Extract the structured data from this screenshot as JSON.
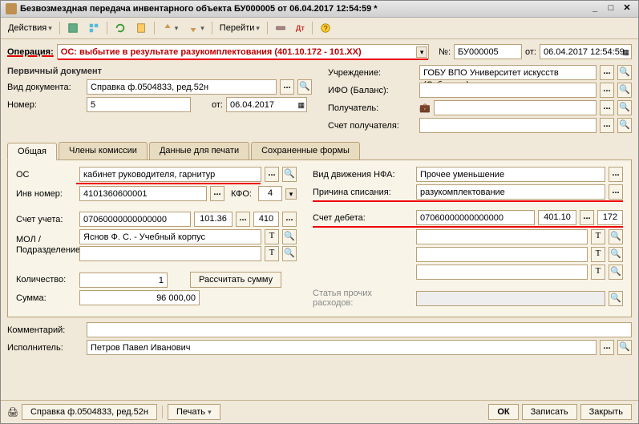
{
  "titlebar": {
    "text": "Безвозмездная передача инвентарного объекта БУ000005 от 06.04.2017 12:54:59 *"
  },
  "toolbar": {
    "actions": "Действия",
    "goto": "Перейти"
  },
  "op": {
    "label": "Операция:",
    "value": "ОС: выбытие в результате разукомплектования (401.10.172 - 101.XX)",
    "num_label": "№:",
    "num": "БУ000005",
    "from_label": "от:",
    "date": "06.04.2017 12:54:59"
  },
  "primary": {
    "title": "Первичный документ",
    "doc_type_label": "Вид документа:",
    "doc_type": "Справка ф.0504833, ред.52н",
    "num_label": "Номер:",
    "num": "5",
    "from_label": "от:",
    "date": "06.04.2017"
  },
  "right": {
    "org_label": "Учреждение:",
    "org": "ГОБУ ВПО Университет искусств (Субсидия)",
    "ifo_label": "ИФО (Баланс):",
    "ifo": "",
    "recipient_label": "Получатель:",
    "recipient": "",
    "acct_label": "Счет получателя:",
    "acct": ""
  },
  "tabs": {
    "common": "Общая",
    "commission": "Члены комиссии",
    "print": "Данные для печати",
    "saved": "Сохраненные формы"
  },
  "tabpane": {
    "os_label": "ОС",
    "os": "кабинет руководителя, гарнитур",
    "inv_label": "Инв номер:",
    "inv": "4101360600001",
    "kfo_label": "КФО:",
    "kfo": "4",
    "account_label": "Счет учета:",
    "account": "07060000000000000",
    "account_b": "101.36",
    "account_c": "410",
    "mol_label": "МОЛ / Подразделение:",
    "mol": "Яснов Ф. С. - Учебный корпус",
    "qty_label": "Количество:",
    "qty": "1",
    "recalc_btn": "Рассчитать сумму",
    "sum_label": "Сумма:",
    "sum": "96 000,00",
    "nfa_label": "Вид движения НФА:",
    "nfa": "Прочее уменьшение",
    "reason_label": "Причина списания:",
    "reason": "разукомплектование",
    "debit_label": "Счет дебета:",
    "debit_a": "07060000000000000",
    "debit_b": "401.10",
    "debit_c": "172",
    "expense_label": "Статья прочих расходов:",
    "expense": ""
  },
  "bottom": {
    "comment_label": "Комментарий:",
    "executor_label": "Исполнитель:",
    "executor": "Петров Павел Иванович"
  },
  "footer": {
    "doc": "Справка ф.0504833, ред.52н",
    "print": "Печать",
    "ok": "ОК",
    "save": "Записать",
    "close": "Закрыть"
  }
}
